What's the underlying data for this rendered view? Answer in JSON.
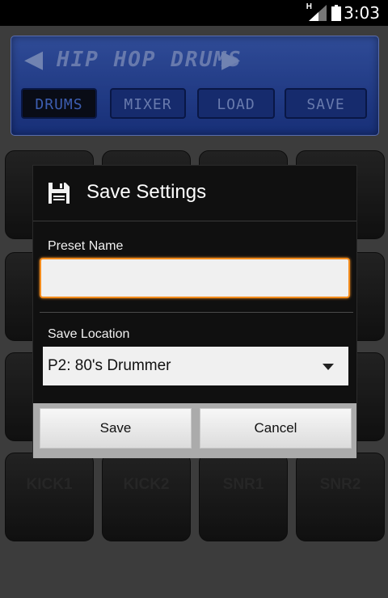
{
  "status_bar": {
    "network_mark": "H",
    "time": "3:03",
    "icons": [
      "signal-icon",
      "battery-icon"
    ]
  },
  "header": {
    "kit_title": "HIP HOP DRUMS",
    "prev_arrow": "◀",
    "next_arrow": "▶",
    "nav": [
      {
        "label": "DRUMS",
        "active": true
      },
      {
        "label": "MIXER",
        "active": false
      },
      {
        "label": "LOAD",
        "active": false
      },
      {
        "label": "SAVE",
        "active": false
      }
    ]
  },
  "pads": {
    "bottom_row": [
      "KICK1",
      "KICK2",
      "SNR1",
      "SNR2"
    ]
  },
  "dialog": {
    "title": "Save Settings",
    "title_icon": "floppy-disk-icon",
    "preset_label": "Preset Name",
    "preset_value": "",
    "location_label": "Save Location",
    "location_value": "P2: 80's Drummer",
    "save_label": "Save",
    "cancel_label": "Cancel"
  },
  "colors": {
    "accent_focus": "#f28b1c",
    "panel_blue": "#2a4aa8"
  }
}
